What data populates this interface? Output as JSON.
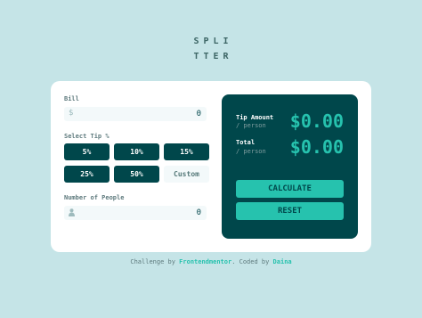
{
  "logo": {
    "line1": "SPLI",
    "line2": "TTER"
  },
  "bill": {
    "label": "Bill",
    "icon": "dollar-icon",
    "icon_glyph": "$",
    "value": "0"
  },
  "tip": {
    "label": "Select Tip %",
    "options": [
      "5%",
      "10%",
      "15%",
      "25%",
      "50%"
    ],
    "custom_label": "Custom"
  },
  "people": {
    "label": "Number of People",
    "icon": "person-icon",
    "value": "0"
  },
  "result": {
    "tip_label": "Tip Amount",
    "tip_sub": "/ person",
    "tip_value": "$0.00",
    "total_label": "Total",
    "total_sub": "/ person",
    "total_value": "$0.00",
    "calculate_label": "CALCULATE",
    "reset_label": "RESET"
  },
  "attribution": {
    "prefix": "Challenge by ",
    "challenge_link": "Frontendmentor",
    "middle": ". Coded by ",
    "author_link": "Daina"
  },
  "colors": {
    "background": "#c5e4e7",
    "dark_cyan": "#00474b",
    "accent": "#26c2ae",
    "card": "#ffffff"
  }
}
